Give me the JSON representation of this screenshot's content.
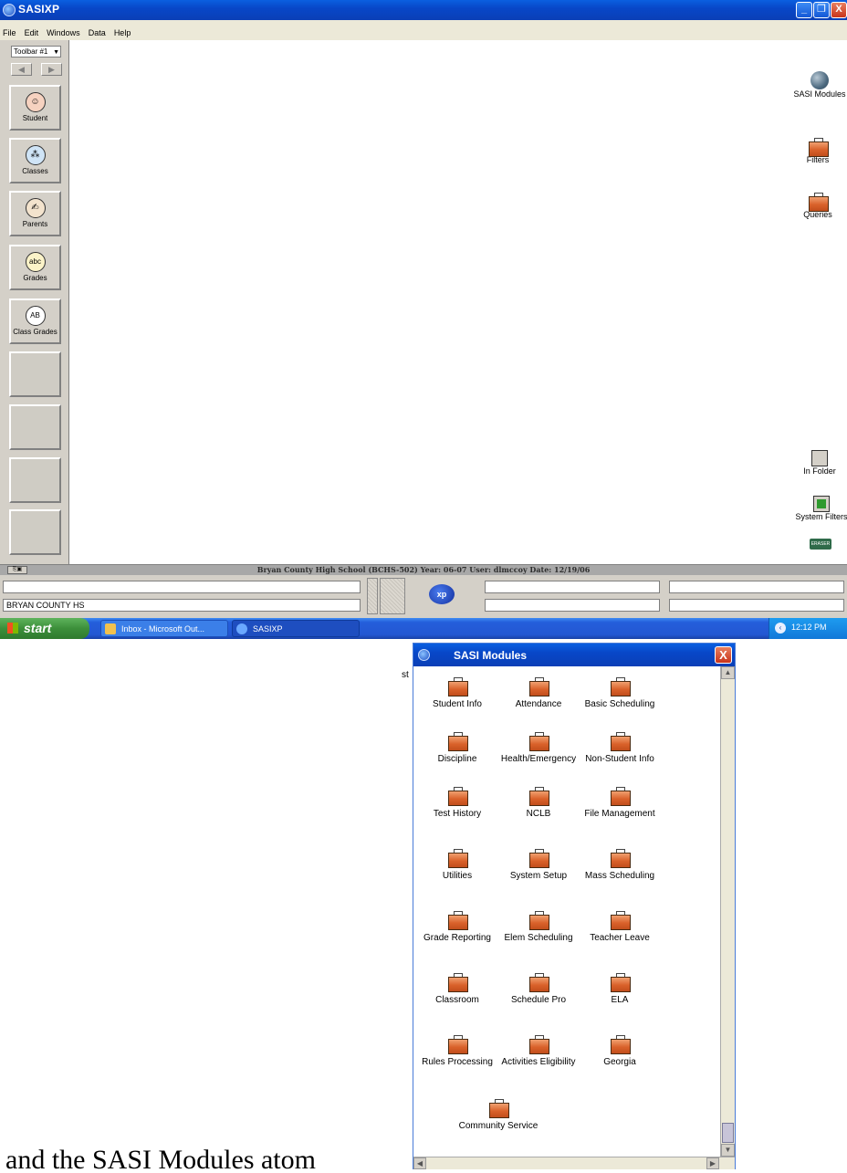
{
  "window": {
    "title": "SASIXP",
    "menu": [
      "File",
      "Edit",
      "Windows",
      "Data",
      "Help"
    ],
    "controls": {
      "minimize": "_",
      "restore": "❐",
      "close": "X"
    }
  },
  "toolbar": {
    "selector": "Toolbar #1",
    "prev": "◀",
    "next": "▶",
    "buttons": [
      {
        "label": "Student",
        "icon": "student-icon"
      },
      {
        "label": "Classes",
        "icon": "classes-icon"
      },
      {
        "label": "Parents",
        "icon": "parents-icon"
      },
      {
        "label": "Grades",
        "icon": "grades-icon"
      },
      {
        "label": "Class Grades",
        "icon": "class-grades-icon"
      }
    ]
  },
  "desktop_icons": [
    {
      "label": "SASI Modules",
      "icon": "globe-icon"
    },
    {
      "label": "Filters",
      "icon": "briefcase-icon"
    },
    {
      "label": "Queries",
      "icon": "briefcase-icon"
    },
    {
      "label": "In Folder",
      "icon": "in-folder-icon"
    },
    {
      "label": "System Filters",
      "icon": "system-filter-icon"
    },
    {
      "label": "ERASER",
      "icon": "eraser-icon"
    }
  ],
  "status": {
    "info": "Bryan County High School (BCHS-502)  Year: 06-07  User: dlmccoy  Date: 12/19/06",
    "school_field": "BRYAN COUNTY HS",
    "logo": "xp"
  },
  "taskbar": {
    "start": "start",
    "items": [
      "Inbox - Microsoft Out...",
      "SASIXP"
    ],
    "clock": "12:12 PM"
  },
  "modules_window": {
    "title": "SASI Modules",
    "close": "X",
    "stub_text": "st",
    "modules": [
      "Student Info",
      "Attendance",
      "Basic Scheduling",
      "Discipline",
      "Health/Emergency",
      "Non-Student Info",
      "Test History",
      "NCLB",
      "File Management",
      "Utilities",
      "System Setup",
      "Mass Scheduling",
      "Grade Reporting",
      "Elem Scheduling",
      "Teacher Leave",
      "Classroom",
      "Schedule Pro",
      "ELA",
      "Rules Processing",
      "Activities Eligibility",
      "Georgia",
      "Community Service"
    ]
  },
  "caption": "and the SASI Modules atom"
}
